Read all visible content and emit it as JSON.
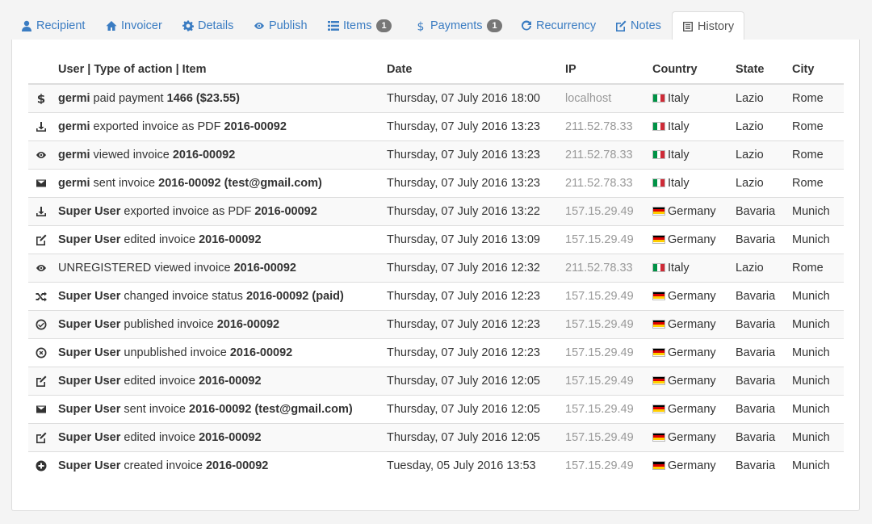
{
  "tabs": [
    {
      "label": "Recipient",
      "icon": "user-icon"
    },
    {
      "label": "Invoicer",
      "icon": "home-icon"
    },
    {
      "label": "Details",
      "icon": "gear-icon"
    },
    {
      "label": "Publish",
      "icon": "eye-icon"
    },
    {
      "label": "Items",
      "icon": "list-icon",
      "badge": "1"
    },
    {
      "label": "Payments",
      "icon": "dollar-icon",
      "badge": "1"
    },
    {
      "label": "Recurrency",
      "icon": "refresh-icon"
    },
    {
      "label": "Notes",
      "icon": "edit-icon"
    },
    {
      "label": "History",
      "icon": "history-icon",
      "active": true
    }
  ],
  "table": {
    "headers": {
      "action": "User | Type of action | Item",
      "date": "Date",
      "ip": "IP",
      "country": "Country",
      "state": "State",
      "city": "City"
    },
    "rows": [
      {
        "icon": "dollar-icon",
        "user": "germi",
        "action": " paid payment ",
        "item": "1466 ($23.55)",
        "date": "Thursday, 07 July 2016 18:00",
        "ip": "localhost",
        "flag": "it",
        "country": "Italy",
        "state": "Lazio",
        "city": "Rome"
      },
      {
        "icon": "download-icon",
        "user": "germi",
        "action": " exported invoice as PDF ",
        "item": "2016-00092",
        "date": "Thursday, 07 July 2016 13:23",
        "ip": "211.52.78.33",
        "flag": "it",
        "country": "Italy",
        "state": "Lazio",
        "city": "Rome"
      },
      {
        "icon": "eye-icon",
        "user": "germi",
        "action": " viewed invoice ",
        "item": "2016-00092",
        "date": "Thursday, 07 July 2016 13:23",
        "ip": "211.52.78.33",
        "flag": "it",
        "country": "Italy",
        "state": "Lazio",
        "city": "Rome"
      },
      {
        "icon": "envelope-icon",
        "user": "germi",
        "action": " sent invoice ",
        "item": "2016-00092 (test@gmail.com)",
        "date": "Thursday, 07 July 2016 13:23",
        "ip": "211.52.78.33",
        "flag": "it",
        "country": "Italy",
        "state": "Lazio",
        "city": "Rome"
      },
      {
        "icon": "download-icon",
        "user": "Super User",
        "action": " exported invoice as PDF ",
        "item": "2016-00092",
        "date": "Thursday, 07 July 2016 13:22",
        "ip": "157.15.29.49",
        "flag": "de",
        "country": "Germany",
        "state": "Bavaria",
        "city": "Munich"
      },
      {
        "icon": "edit-icon",
        "user": "Super User",
        "action": " edited invoice ",
        "item": "2016-00092",
        "date": "Thursday, 07 July 2016 13:09",
        "ip": "157.15.29.49",
        "flag": "de",
        "country": "Germany",
        "state": "Bavaria",
        "city": "Munich"
      },
      {
        "icon": "eye-icon",
        "user": "",
        "action": "UNREGISTERED viewed invoice ",
        "item": "2016-00092",
        "date": "Thursday, 07 July 2016 12:32",
        "ip": "211.52.78.33",
        "flag": "it",
        "country": "Italy",
        "state": "Lazio",
        "city": "Rome"
      },
      {
        "icon": "shuffle-icon",
        "user": "Super User",
        "action": " changed invoice status ",
        "item": "2016-00092 (paid)",
        "date": "Thursday, 07 July 2016 12:23",
        "ip": "157.15.29.49",
        "flag": "de",
        "country": "Germany",
        "state": "Bavaria",
        "city": "Munich"
      },
      {
        "icon": "check-circle-icon",
        "user": "Super User",
        "action": " published invoice ",
        "item": "2016-00092",
        "date": "Thursday, 07 July 2016 12:23",
        "ip": "157.15.29.49",
        "flag": "de",
        "country": "Germany",
        "state": "Bavaria",
        "city": "Munich"
      },
      {
        "icon": "x-circle-icon",
        "user": "Super User",
        "action": " unpublished invoice ",
        "item": "2016-00092",
        "date": "Thursday, 07 July 2016 12:23",
        "ip": "157.15.29.49",
        "flag": "de",
        "country": "Germany",
        "state": "Bavaria",
        "city": "Munich"
      },
      {
        "icon": "edit-icon",
        "user": "Super User",
        "action": " edited invoice ",
        "item": "2016-00092",
        "date": "Thursday, 07 July 2016 12:05",
        "ip": "157.15.29.49",
        "flag": "de",
        "country": "Germany",
        "state": "Bavaria",
        "city": "Munich"
      },
      {
        "icon": "envelope-icon",
        "user": "Super User",
        "action": " sent invoice ",
        "item": "2016-00092 (test@gmail.com)",
        "date": "Thursday, 07 July 2016 12:05",
        "ip": "157.15.29.49",
        "flag": "de",
        "country": "Germany",
        "state": "Bavaria",
        "city": "Munich"
      },
      {
        "icon": "edit-icon",
        "user": "Super User",
        "action": " edited invoice ",
        "item": "2016-00092",
        "date": "Thursday, 07 July 2016 12:05",
        "ip": "157.15.29.49",
        "flag": "de",
        "country": "Germany",
        "state": "Bavaria",
        "city": "Munich"
      },
      {
        "icon": "plus-circle-icon",
        "user": "Super User",
        "action": " created invoice ",
        "item": "2016-00092",
        "date": "Tuesday, 05 July 2016 13:53",
        "ip": "157.15.29.49",
        "flag": "de",
        "country": "Germany",
        "state": "Bavaria",
        "city": "Munich"
      }
    ]
  },
  "colors": {
    "link": "#3a7cc2",
    "badge": "#777777",
    "ip": "#999999"
  }
}
